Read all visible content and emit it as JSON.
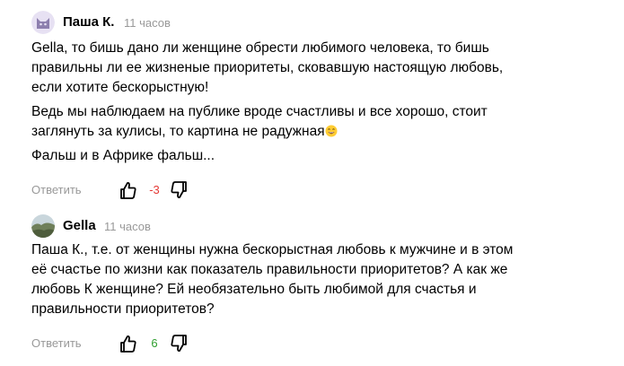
{
  "comments": [
    {
      "author": "Паша К.",
      "time": "11 часов",
      "paragraphs": [
        "Gella, то бишь дано ли женщине обрести любимого человека, то бишь",
        "правильны ли ее жизненые приоритеты, сковавшую настоящую любовь,",
        "если хотите бескорыстную!"
      ],
      "paragraph2_lines": [
        "Ведь мы наблюдаем на публике вроде счастливы и все хорошо, стоит",
        "заглянуть за кулисы, то картина не радужная"
      ],
      "paragraph3": "Фальш и в Африке фальш...",
      "reply_label": "Ответить",
      "score": "-3",
      "score_color": "#e53935",
      "avatar_icon": "cat-avatar-icon"
    },
    {
      "author": "Gella",
      "time": "11 часов",
      "lines": [
        "Паша К., т.е. от женщины нужна бескорыстная любовь к мужчине и в этом",
        "её счастье по жизни как показатель правильности приоритетов? А как же",
        "любовь К женщине? Ей необязательно быть любимой для счастья и",
        "правильности приоритетов?"
      ],
      "reply_label": "Ответить",
      "score": "6",
      "score_color": "#2e9e2e",
      "avatar_icon": "landscape-avatar-icon"
    }
  ]
}
